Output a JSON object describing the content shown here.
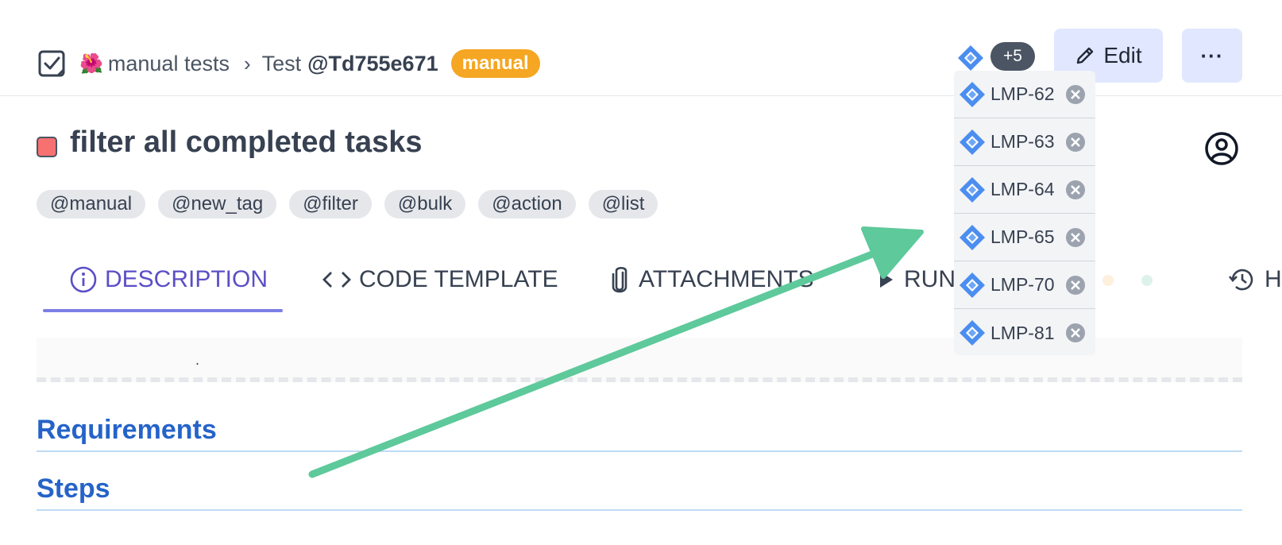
{
  "breadcrumb": {
    "emoji": "🌺",
    "suite": "manual tests",
    "separator": "›",
    "test_prefix": "Test",
    "test_id": "@Td755e671",
    "badge": "manual"
  },
  "header": {
    "linked_more_badge": "+5",
    "edit_label": "Edit",
    "more_label": "···"
  },
  "test": {
    "title": "filter all completed tasks",
    "status_color": "#f87171",
    "tags": [
      "@manual",
      "@new_tag",
      "@filter",
      "@bulk",
      "@action",
      "@list"
    ]
  },
  "tabs": [
    {
      "label": "DESCRIPTION",
      "icon": "info-icon",
      "active": true
    },
    {
      "label": "CODE TEMPLATE",
      "icon": "code-icon",
      "active": false
    },
    {
      "label": "ATTACHMENTS",
      "icon": "paperclip-icon",
      "active": false
    },
    {
      "label": "RUN",
      "icon": "play-icon",
      "active": false
    },
    {
      "label": "H",
      "icon": "history-icon",
      "active": false
    }
  ],
  "description": {
    "text": "."
  },
  "sections": [
    {
      "heading": "Requirements"
    },
    {
      "heading": "Steps"
    }
  ],
  "jira_dropdown": {
    "items": [
      "LMP-62",
      "LMP-63",
      "LMP-64",
      "LMP-65",
      "LMP-70",
      "LMP-81"
    ]
  },
  "colors": {
    "accent": "#5b4fc7",
    "section_heading": "#2563c9",
    "badge_manual": "#f5a623",
    "button_bg": "#e0e7ff",
    "annotation_arrow": "#5ec99b"
  }
}
